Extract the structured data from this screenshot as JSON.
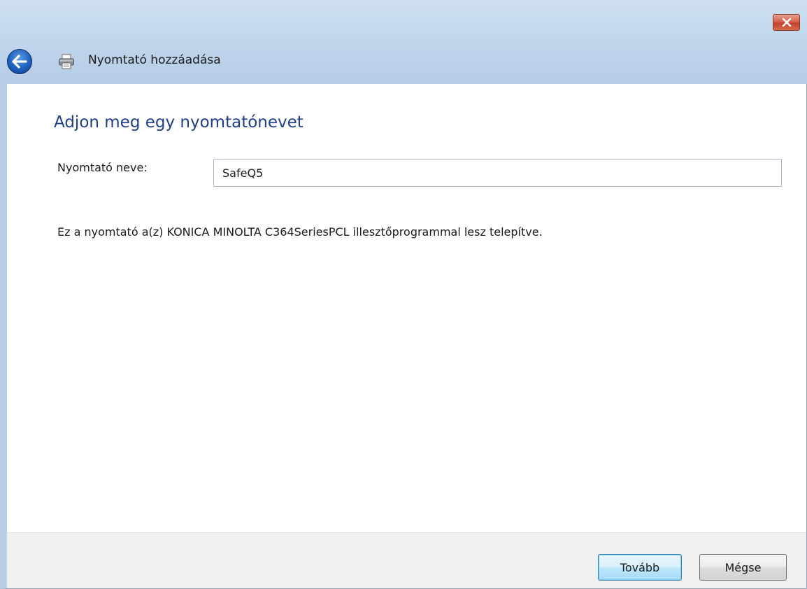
{
  "window": {
    "title": "Nyomtató hozzáadása",
    "close_icon": "close-icon",
    "back_icon": "back-arrow-icon",
    "app_icon": "printer-icon"
  },
  "main": {
    "heading": "Adjon meg egy nyomtatónevet",
    "printer_name_label": "Nyomtató neve:",
    "printer_name_value": "SafeQ5",
    "info_text": "Ez a nyomtató a(z) KONICA MINOLTA C364SeriesPCL illesztőprogrammal lesz telepítve."
  },
  "footer": {
    "next_label": "Tovább",
    "cancel_label": "Mégse"
  },
  "colors": {
    "heading": "#1e3f8c",
    "frame": "#bed3ea",
    "close_button": "#c2432a",
    "default_button_border": "#3c7fb1"
  }
}
